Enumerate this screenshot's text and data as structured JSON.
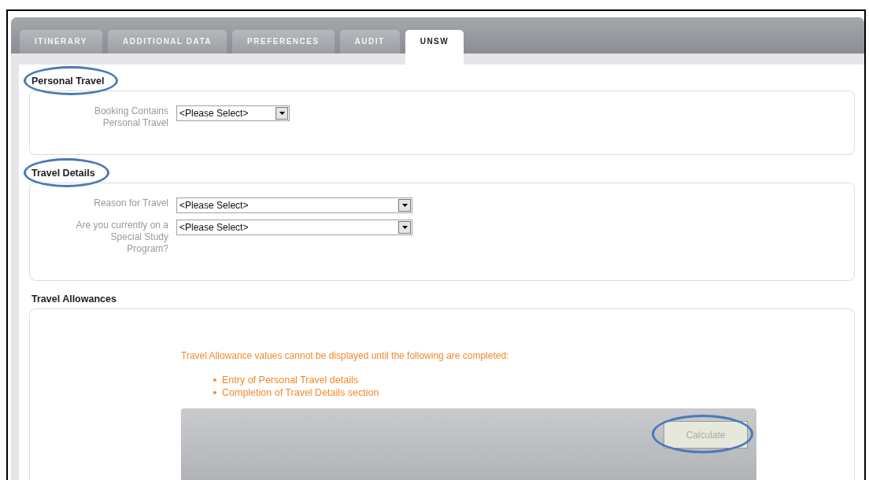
{
  "tabs": [
    {
      "label": "ITINERARY",
      "selected": false
    },
    {
      "label": "ADDITIONAL DATA",
      "selected": false
    },
    {
      "label": "PREFERENCES",
      "selected": false
    },
    {
      "label": "AUDIT",
      "selected": false
    },
    {
      "label": "UNSW",
      "selected": true
    }
  ],
  "sections": [
    {
      "heading": "Personal Travel",
      "highlighted": true,
      "fields": [
        {
          "label": "Booking Contains Personal Travel",
          "value": "<Please Select>",
          "kind": "short"
        }
      ]
    },
    {
      "heading": "Travel Details",
      "highlighted": true,
      "fields": [
        {
          "label": "Reason for Travel",
          "value": "<Please Select>",
          "kind": "long"
        },
        {
          "label": "Are you currently on a Special Study Program?",
          "value": "<Please Select>",
          "kind": "long"
        }
      ]
    }
  ],
  "allowances": {
    "heading": "Travel Allowances",
    "message": "Travel Allowance values cannot be displayed until the following are completed:",
    "requirements": [
      "Entry of Personal Travel details",
      "Completion of Travel Details section"
    ],
    "button": {
      "label": "Calculate",
      "disabled": true,
      "highlighted": true
    }
  }
}
